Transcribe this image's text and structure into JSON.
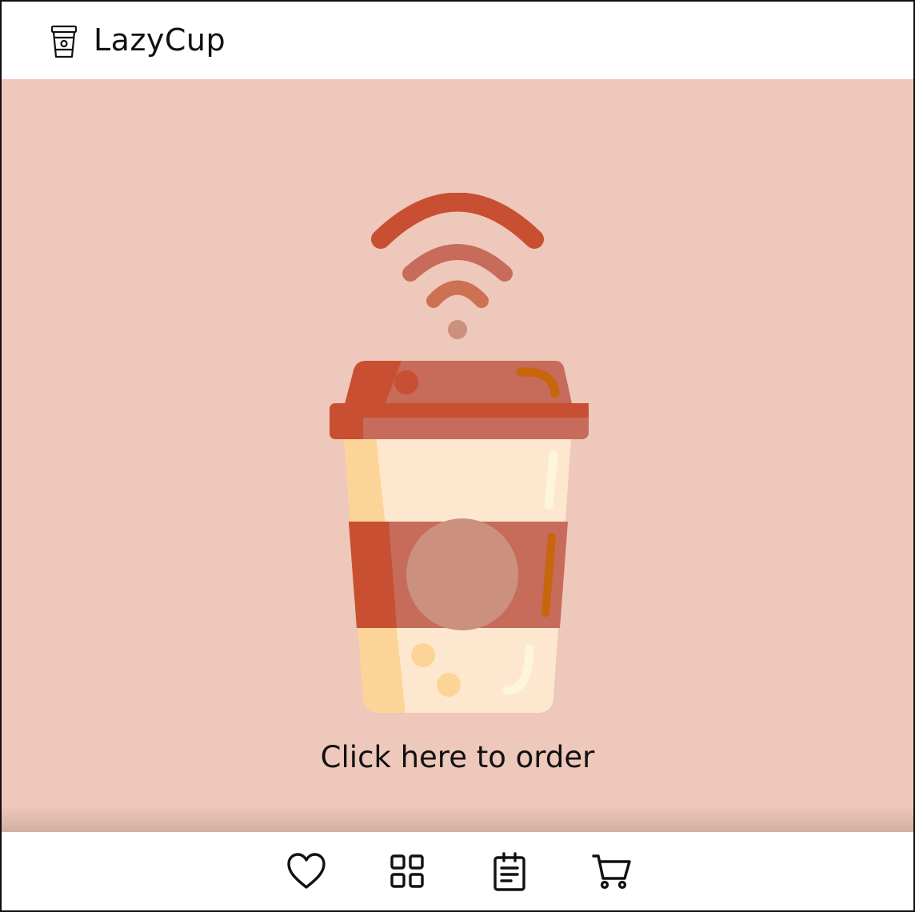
{
  "header": {
    "brand": "LazyCup",
    "brand_icon": "coffee-cup-icon"
  },
  "hero": {
    "illustration": "wireless-coffee-cup-illustration",
    "cta_label": "Click here to order",
    "background": "#eec8ba"
  },
  "bottom_nav": {
    "items": [
      {
        "icon": "heart-icon"
      },
      {
        "icon": "grid-icon"
      },
      {
        "icon": "notepad-icon"
      },
      {
        "icon": "cart-icon"
      }
    ]
  },
  "colors": {
    "accent_dark": "#c84f31",
    "accent_mid": "#c76b5a",
    "cream": "#fde8cf",
    "sand": "#fdd497"
  }
}
